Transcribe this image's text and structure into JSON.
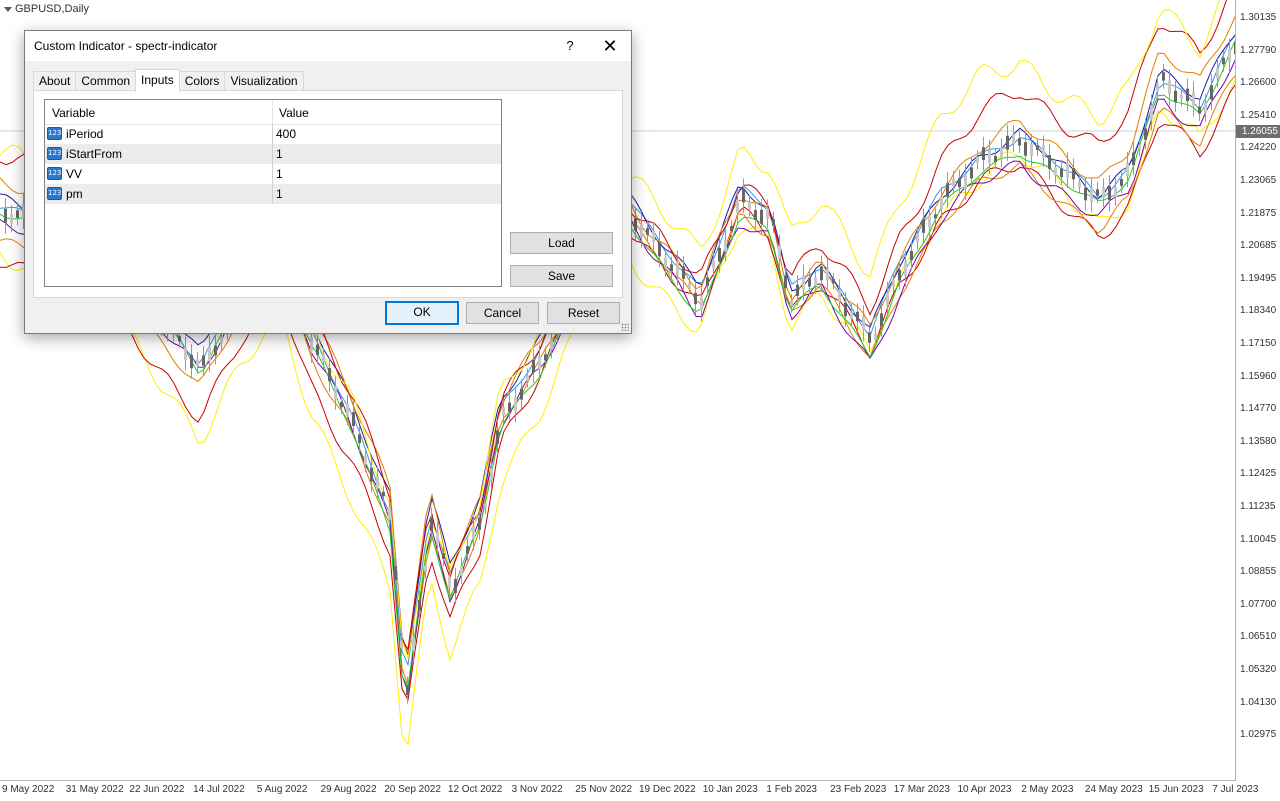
{
  "chart": {
    "symbol": "GBPUSD,Daily",
    "current_price": "1.26055",
    "price_labels": [
      "1.30135",
      "1.27790",
      "1.26600",
      "1.25410",
      "1.24220",
      "1.23065",
      "1.21875",
      "1.20685",
      "1.19495",
      "1.18340",
      "1.17150",
      "1.15960",
      "1.14770",
      "1.13580",
      "1.12425",
      "1.11235",
      "1.10045",
      "1.08855",
      "1.07700",
      "1.06510",
      "1.05320",
      "1.04130",
      "1.02975"
    ],
    "time_labels": [
      "9 May 2022",
      "31 May 2022",
      "22 Jun 2022",
      "14 Jul 2022",
      "5 Aug 2022",
      "29 Aug 2022",
      "20 Sep 2022",
      "12 Oct 2022",
      "3 Nov 2022",
      "25 Nov 2022",
      "19 Dec 2022",
      "10 Jan 2023",
      "1 Feb 2023",
      "23 Feb 2023",
      "17 Mar 2023",
      "10 Apr 2023",
      "2 May 2023",
      "24 May 2023",
      "15 Jun 2023",
      "7 Jul 2023"
    ],
    "colors": {
      "red": "#c80000",
      "orange": "#e08000",
      "yellow": "#ffee00",
      "green": "#22cc22",
      "blue": "#1a1aaa",
      "purple": "#7a00b0",
      "skyblue": "#3399dd",
      "candle": "#666666"
    }
  },
  "dialog": {
    "title": "Custom Indicator - spectr-indicator",
    "help_label": "?",
    "close_label": "✕",
    "tabs": [
      {
        "label": "About",
        "active": false
      },
      {
        "label": "Common",
        "active": false
      },
      {
        "label": "Inputs",
        "active": true
      },
      {
        "label": "Colors",
        "active": false
      },
      {
        "label": "Visualization",
        "active": false
      }
    ],
    "grid": {
      "col_variable": "Variable",
      "col_value": "Value",
      "icon_text": "123",
      "rows": [
        {
          "name": "iPeriod",
          "value": "400"
        },
        {
          "name": "iStartFrom",
          "value": "1"
        },
        {
          "name": "VV",
          "value": "1"
        },
        {
          "name": "pm",
          "value": "1"
        }
      ]
    },
    "buttons": {
      "load": "Load",
      "save": "Save",
      "ok": "OK",
      "cancel": "Cancel",
      "reset": "Reset"
    }
  }
}
